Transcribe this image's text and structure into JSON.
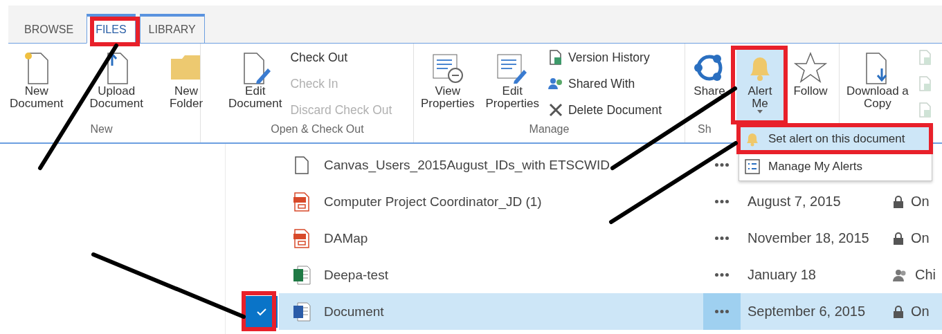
{
  "tabs": [
    {
      "label": "BROWSE",
      "selected": false
    },
    {
      "label": "FILES",
      "selected": true
    },
    {
      "label": "LIBRARY",
      "selected": false
    }
  ],
  "ribbon": {
    "groups": [
      {
        "title": "New",
        "items": [
          {
            "kind": "large",
            "lines": [
              "New",
              "Document"
            ]
          },
          {
            "kind": "large",
            "lines": [
              "Upload",
              "Document"
            ]
          },
          {
            "kind": "large",
            "lines": [
              "New",
              "Folder"
            ]
          }
        ]
      },
      {
        "title": "Open & Check Out",
        "items": [
          {
            "kind": "large",
            "lines": [
              "Edit",
              "Document"
            ]
          },
          {
            "kind": "stack",
            "entries": [
              {
                "label": "Check Out",
                "disabled": false
              },
              {
                "label": "Check In",
                "disabled": true
              },
              {
                "label": "Discard Check Out",
                "disabled": true
              }
            ]
          }
        ]
      },
      {
        "title": "Manage",
        "items": [
          {
            "kind": "large",
            "lines": [
              "View",
              "Properties"
            ]
          },
          {
            "kind": "large",
            "lines": [
              "Edit",
              "Properties"
            ]
          },
          {
            "kind": "stack",
            "entries": [
              {
                "label": "Version History",
                "disabled": false
              },
              {
                "label": "Shared With",
                "disabled": false
              },
              {
                "label": "Delete Document",
                "disabled": false
              }
            ]
          }
        ]
      },
      {
        "title": "Sh",
        "items": [
          {
            "kind": "large",
            "lines": [
              "Share"
            ]
          },
          {
            "kind": "split",
            "lines": [
              "Alert",
              "Me"
            ],
            "selected": true
          },
          {
            "kind": "large",
            "lines": [
              "Follow"
            ]
          }
        ]
      },
      {
        "items": [
          {
            "kind": "large",
            "lines": [
              "Download a",
              "Copy"
            ]
          },
          {
            "kind": "stack",
            "entries": [
              {
                "disabled": true
              },
              {
                "disabled": true
              },
              {
                "disabled": true
              }
            ]
          }
        ]
      }
    ]
  },
  "menu": {
    "items": [
      {
        "label": "Set alert on this document",
        "selected": true
      },
      {
        "label": "Manage My Alerts",
        "selected": false
      }
    ]
  },
  "files": [
    {
      "kind": "doc",
      "name": "Canvas_Users_2015August_IDs_with ETSCWID",
      "selected": false
    },
    {
      "kind": "pdf",
      "name": "Computer Project Coordinator_JD (1)",
      "date": "August 7, 2015",
      "sharing": {
        "kind": "lock",
        "text": "On"
      },
      "selected": false
    },
    {
      "kind": "pdf",
      "name": "DAMap",
      "date": "November 18, 2015",
      "sharing": {
        "kind": "lock",
        "text": "On"
      },
      "selected": false
    },
    {
      "kind": "excel",
      "name": "Deepa-test",
      "date": "January 18",
      "sharing": {
        "kind": "people",
        "text": "Chi"
      },
      "selected": false
    },
    {
      "kind": "word",
      "name": "Document",
      "date": "September 6, 2015",
      "sharing": {
        "kind": "lock",
        "text": "On"
      },
      "selected": true
    }
  ]
}
